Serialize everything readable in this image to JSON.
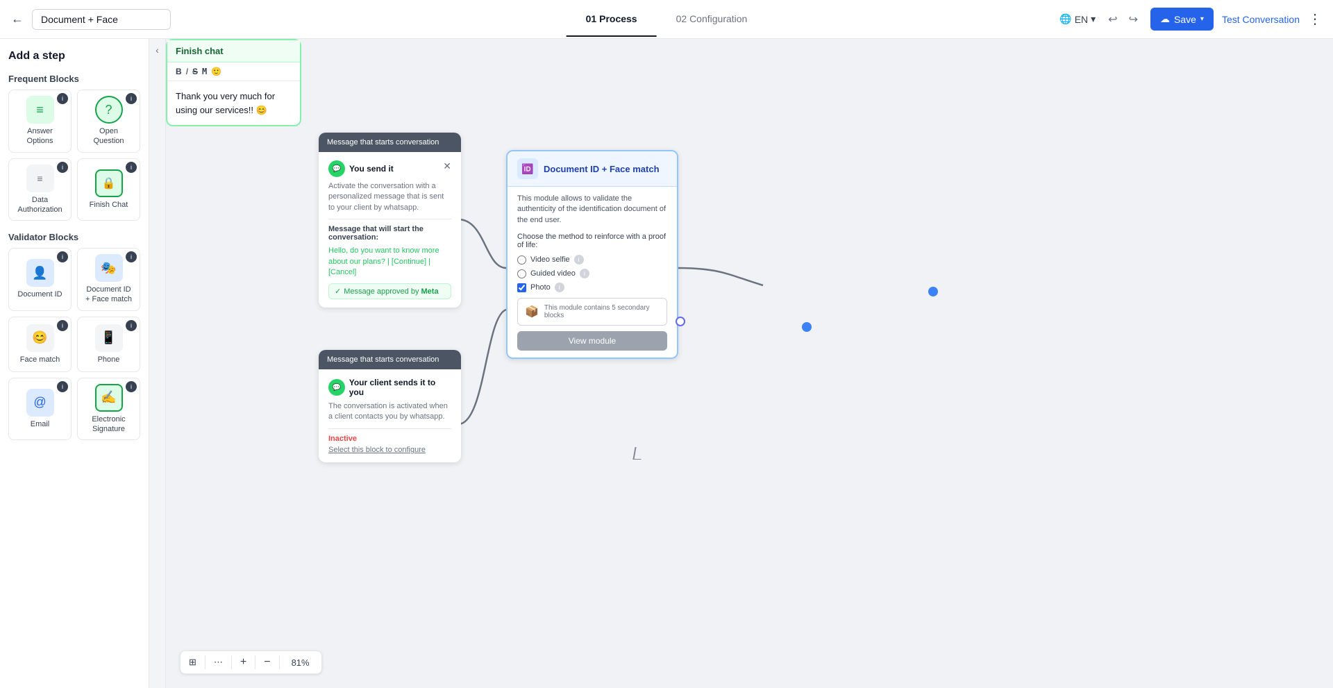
{
  "topbar": {
    "back_label": "←",
    "title": "Document + Face",
    "tab1": "01 Process",
    "tab2": "02 Configuration",
    "lang": "EN",
    "save_label": "Save",
    "test_label": "Test Conversation",
    "more": "⋮"
  },
  "sidebar": {
    "title": "Add a step",
    "frequent_label": "Frequent Blocks",
    "validator_label": "Validator Blocks",
    "blocks": [
      {
        "id": "answer-options",
        "label": "Answer Options",
        "icon": "≡",
        "color": "green"
      },
      {
        "id": "open-question",
        "label": "Open Question",
        "icon": "?",
        "color": "green"
      },
      {
        "id": "data-authorization",
        "label": "Data Authorization",
        "icon": "≡",
        "color": "gray"
      },
      {
        "id": "finish-chat",
        "label": "Finish Chat",
        "icon": "🔒",
        "color": "green-outline"
      }
    ],
    "validator_blocks": [
      {
        "id": "document-id",
        "label": "Document ID",
        "icon": "👤",
        "color": "blue"
      },
      {
        "id": "document-face",
        "label": "Document ID + Face match",
        "icon": "🎭",
        "color": "blue"
      },
      {
        "id": "face-match",
        "label": "Face match",
        "icon": "😊",
        "color": "gray"
      },
      {
        "id": "phone",
        "label": "Phone",
        "icon": "📱",
        "color": "dark"
      },
      {
        "id": "email",
        "label": "Email",
        "icon": "@",
        "color": "blue"
      },
      {
        "id": "electronic-sig",
        "label": "Electronic Signature",
        "icon": "✍",
        "color": "green-outline"
      }
    ]
  },
  "canvas": {
    "msg_card_1": {
      "header": "Message that starts conversation",
      "sender": "You send it",
      "description": "Activate the conversation with a personalized message that is sent to your client by whatsapp.",
      "bubble_label": "Message that will start the conversation:",
      "bubble_text": "Hello, do you want to know more about our plans? | [Continue] | [Cancel]",
      "approved": "Message approved by Meta"
    },
    "msg_card_2": {
      "header": "Message that starts conversation",
      "sender": "Your client sends it to you",
      "description": "The conversation is activated when a client contacts you by whatsapp.",
      "inactive": "Inactive",
      "config": "Select this block to configure"
    },
    "doc_card": {
      "title": "Document ID + Face match",
      "description": "This module allows to validate the authenticity of the identification document of the end user.",
      "choose_label": "Choose the method to reinforce with a proof of life:",
      "options": [
        "Video selfie",
        "Guided video",
        "Photo"
      ],
      "photo_checked": true,
      "module_text": "This module contains 5 secondary blocks",
      "view_btn": "View module"
    },
    "finish_card": {
      "title": "Finish chat",
      "message": "Thank you very much for using our services!! 😊"
    },
    "zoom": "81%"
  }
}
